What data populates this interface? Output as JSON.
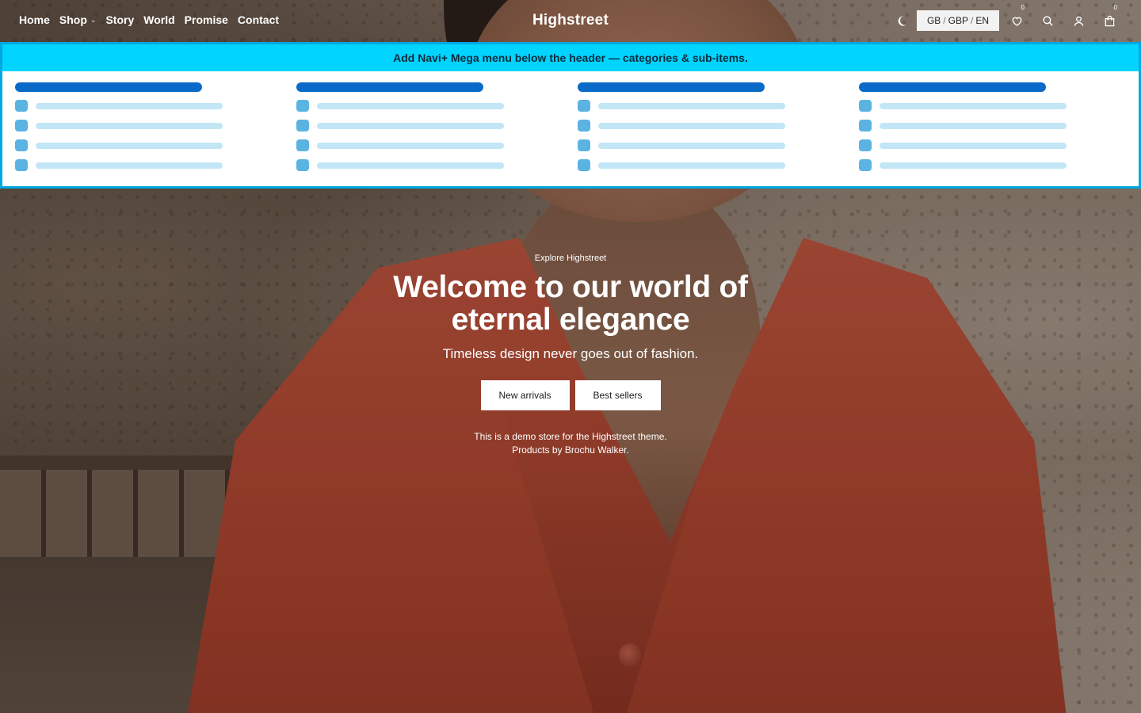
{
  "nav": {
    "items": [
      {
        "label": "Home"
      },
      {
        "label": "Shop"
      },
      {
        "label": "Story"
      },
      {
        "label": "World"
      },
      {
        "label": "Promise"
      },
      {
        "label": "Contact"
      }
    ]
  },
  "brand": {
    "name": "Highstreet"
  },
  "locale": {
    "country": "GB",
    "currency": "GBP",
    "language": "EN",
    "separator": "/"
  },
  "tools": {
    "wishlist_count": "0",
    "cart_count": "0",
    "icons": [
      "moon-icon",
      "heart-icon",
      "search-icon",
      "user-icon",
      "bag-icon"
    ]
  },
  "mega_menu": {
    "banner": "Add Navi+ Mega menu below the header — categories & sub-items.",
    "banner_color": "#00d4ff",
    "heading_color": "#0a6ac7",
    "item_color": "#c3e6f6"
  },
  "hero": {
    "eyebrow": "Explore Highstreet",
    "headline": "Welcome to our world of eternal elegance",
    "subheading": "Timeless design never goes out of fashion.",
    "buttons": {
      "primary": "New arrivals",
      "secondary": "Best sellers"
    },
    "note_line1": "This is a demo store for the Highstreet theme.",
    "note_line2": "Products by Brochu Walker."
  }
}
